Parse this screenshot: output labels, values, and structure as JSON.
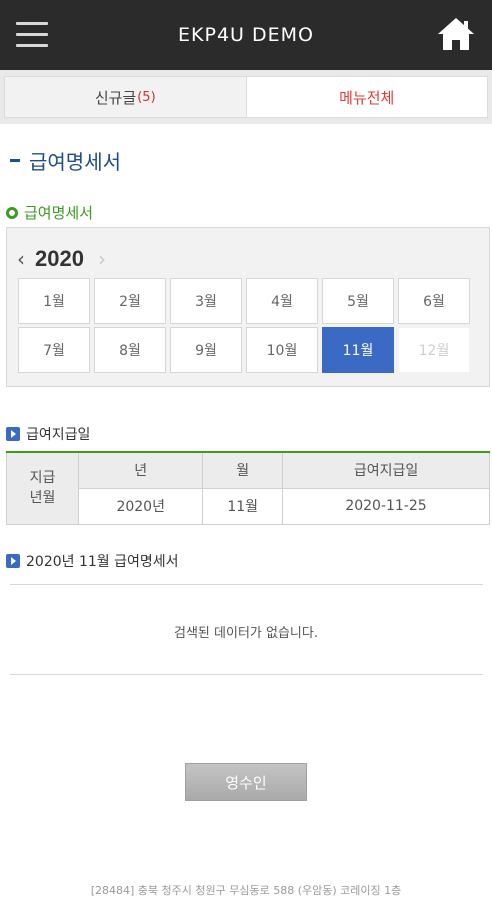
{
  "header": {
    "title": "EKP4U DEMO",
    "menu_icon": "hamburger-menu-icon",
    "home_icon": "home-icon"
  },
  "tabs": {
    "new_label": "신규글",
    "new_count": "(5)",
    "all_label": "메뉴전체"
  },
  "page_title": "급여명세서",
  "calendar": {
    "section_title": "급여명세서",
    "year": "2020",
    "prev": "‹",
    "next": "›",
    "months": [
      "1월",
      "2월",
      "3월",
      "4월",
      "5월",
      "6월",
      "7월",
      "8월",
      "9월",
      "10월",
      "11월",
      "12월"
    ],
    "selected_month": "11월",
    "disabled_month": "12월"
  },
  "pay_section": {
    "title": "급여지급일",
    "row_header": "지급\n년월",
    "col_year": "년",
    "col_month": "월",
    "col_paydate": "급여지급일",
    "year_value": "2020년",
    "month_value": "11월",
    "paydate_value": "2020-11-25"
  },
  "statement_section": {
    "title": "2020년 11월 급여명세서",
    "empty_message": "검색된 데이터가 없습니다."
  },
  "receipt_button": "영수인",
  "footer": "[28484] 충북 청주시 청원구 무심동로 588 (우암동) 코레이징 1층",
  "colors": {
    "header_bg": "#2b2b2b",
    "accent_blue": "#3b6ac4",
    "accent_green": "#3c9a1e",
    "accent_red": "#e53935"
  }
}
